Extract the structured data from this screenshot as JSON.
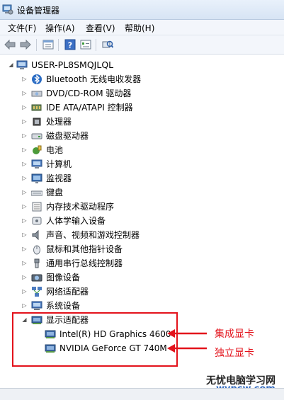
{
  "window": {
    "title": "设备管理器"
  },
  "menu": [
    {
      "label": "文件(F)"
    },
    {
      "label": "操作(A)"
    },
    {
      "label": "查看(V)"
    },
    {
      "label": "帮助(H)"
    }
  ],
  "toolbar": [
    "back-icon",
    "forward-icon",
    "properties-icon",
    "help-icon",
    "view-icon",
    "scan-hardware-icon"
  ],
  "tree": {
    "root": {
      "label": "USER-PL8SMQJLQL",
      "icon": "computer-icon"
    },
    "categories": [
      {
        "label": "Bluetooth 无线电收发器",
        "icon": "bluetooth-icon"
      },
      {
        "label": "DVD/CD-ROM 驱动器",
        "icon": "dvd-drive-icon"
      },
      {
        "label": "IDE ATA/ATAPI 控制器",
        "icon": "ide-controller-icon"
      },
      {
        "label": "处理器",
        "icon": "processor-icon"
      },
      {
        "label": "磁盘驱动器",
        "icon": "disk-drive-icon"
      },
      {
        "label": "电池",
        "icon": "battery-icon"
      },
      {
        "label": "计算机",
        "icon": "computer-icon"
      },
      {
        "label": "监视器",
        "icon": "monitor-icon"
      },
      {
        "label": "键盘",
        "icon": "keyboard-icon"
      },
      {
        "label": "内存技术驱动程序",
        "icon": "memory-icon"
      },
      {
        "label": "人体学输入设备",
        "icon": "hid-icon"
      },
      {
        "label": "声音、视频和游戏控制器",
        "icon": "sound-icon"
      },
      {
        "label": "鼠标和其他指针设备",
        "icon": "mouse-icon"
      },
      {
        "label": "通用串行总线控制器",
        "icon": "usb-icon"
      },
      {
        "label": "图像设备",
        "icon": "camera-icon"
      },
      {
        "label": "网络适配器",
        "icon": "network-adapter-icon"
      },
      {
        "label": "系统设备",
        "icon": "system-device-icon"
      },
      {
        "label": "显示适配器",
        "icon": "display-adapter-icon"
      }
    ],
    "display_children": [
      {
        "label": "Intel(R) HD Graphics 4600",
        "icon": "display-adapter-icon"
      },
      {
        "label": "NVIDIA GeForce GT 740M",
        "icon": "display-adapter-icon"
      }
    ]
  },
  "annotations": {
    "integrated": "集成显卡",
    "discrete": "独立显卡",
    "color": "#e3121b"
  },
  "watermark": {
    "line1": "无忧电脑学习网",
    "line2": "wypcw.com"
  }
}
